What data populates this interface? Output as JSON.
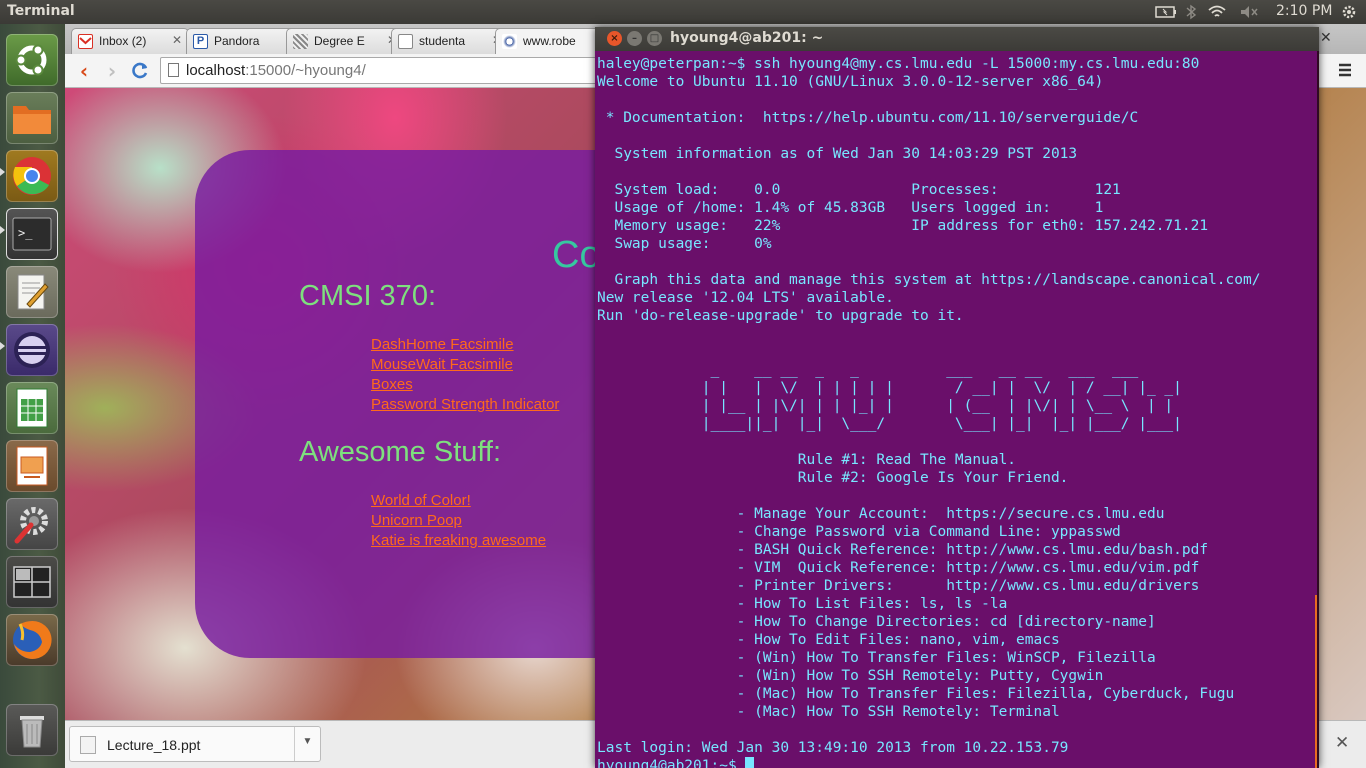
{
  "top_panel": {
    "app_title": "Terminal",
    "clock": "2:10 PM",
    "indicators": [
      "battery-icon",
      "bluetooth-icon",
      "wifi-icon",
      "volume-muted-icon",
      "power-gear-icon"
    ]
  },
  "launcher": {
    "items": [
      {
        "name": "dash-home",
        "icon": "ubuntu-logo-icon"
      },
      {
        "name": "files",
        "icon": "folder-icon"
      },
      {
        "name": "chrome",
        "icon": "chrome-icon"
      },
      {
        "name": "terminal",
        "icon": "terminal-icon"
      },
      {
        "name": "text-editor",
        "icon": "text-editor-icon"
      },
      {
        "name": "eclipse",
        "icon": "eclipse-icon"
      },
      {
        "name": "spreadsheet",
        "icon": "spreadsheet-icon"
      },
      {
        "name": "presentation",
        "icon": "presentation-icon"
      },
      {
        "name": "system-settings",
        "icon": "settings-icon"
      },
      {
        "name": "workspaces",
        "icon": "workspace-switcher-icon"
      },
      {
        "name": "firefox",
        "icon": "firefox-icon"
      },
      {
        "name": "trash",
        "icon": "trash-icon"
      }
    ]
  },
  "browser": {
    "tabs": [
      {
        "label": "Inbox (2)",
        "icon": "gmail-icon",
        "color": "#d93025"
      },
      {
        "label": "Pandora",
        "icon": "pandora-icon",
        "color": "#2b5aa8"
      },
      {
        "label": "Degree E",
        "icon": "degree-icon",
        "color": "#6a6a6a"
      },
      {
        "label": "studenta",
        "icon": "page-icon",
        "color": "#ffffff"
      },
      {
        "label": "www.robe",
        "icon": "robe-icon",
        "color": "#3c5aa0"
      }
    ],
    "address": {
      "host": "localhost",
      "rest": ":15000/~hyoung4/"
    },
    "page": {
      "title_partial": "Co",
      "sections": [
        {
          "heading": "CMSI 370:",
          "links": [
            "DashHome Facsimile",
            "MouseWait Facsimile",
            "Boxes",
            "Password Strength Indicator"
          ]
        },
        {
          "heading": "Awesome Stuff:",
          "links": [
            "World of Color!",
            "Unicorn Poop",
            "Katie is freaking awesome"
          ]
        }
      ]
    },
    "download": {
      "filename": "Lecture_18.ppt",
      "icon": "ppt-icon"
    },
    "close_glyph": "✕",
    "menu_icon": "hamburger-menu-icon"
  },
  "terminal": {
    "title": "hyoung4@ab201: ~",
    "lines": [
      "haley@peterpan:~$ ssh hyoung4@my.cs.lmu.edu -L 15000:my.cs.lmu.edu:80",
      "Welcome to Ubuntu 11.10 (GNU/Linux 3.0.0-12-server x86_64)",
      "",
      " * Documentation:  https://help.ubuntu.com/11.10/serverguide/C",
      "",
      "  System information as of Wed Jan 30 14:03:29 PST 2013",
      "",
      "  System load:    0.0               Processes:           121",
      "  Usage of /home: 1.4% of 45.83GB   Users logged in:     1",
      "  Memory usage:   22%               IP address for eth0: 157.242.71.21",
      "  Swap usage:     0%",
      "",
      "  Graph this data and manage this system at https://landscape.canonical.com/",
      "New release '12.04 LTS' available.",
      "Run 'do-release-upgrade' to upgrade to it.",
      "",
      "",
      "             _    __ __  _   _          ___   __ __   ___  ___",
      "            | |   |  \\/  | | | | |       / __| |  \\/  | / __| |_ _|",
      "            | |__ | |\\/| | | |_| |      | (__  | |\\/| | \\__ \\  | |",
      "            |____||_|  |_|  \\___/        \\___| |_|  |_| |___/ |___|",
      "",
      "                       Rule #1: Read The Manual.",
      "                       Rule #2: Google Is Your Friend.",
      "",
      "                - Manage Your Account:  https://secure.cs.lmu.edu",
      "                - Change Password via Command Line: yppasswd",
      "                - BASH Quick Reference: http://www.cs.lmu.edu/bash.pdf",
      "                - VIM  Quick Reference: http://www.cs.lmu.edu/vim.pdf",
      "                - Printer Drivers:      http://www.cs.lmu.edu/drivers",
      "                - How To List Files: ls, ls -la",
      "                - How To Change Directories: cd [directory-name]",
      "                - How To Edit Files: nano, vim, emacs",
      "                - (Win) How To Transfer Files: WinSCP, Filezilla",
      "                - (Win) How To SSH Remotely: Putty, Cygwin",
      "                - (Mac) How To Transfer Files: Filezilla, Cyberduck, Fugu",
      "                - (Mac) How To SSH Remotely: Terminal",
      "",
      "Last login: Wed Jan 30 13:49:10 2013 from 10.22.153.79"
    ],
    "prompt": "hyoung4@ab201:~$ "
  }
}
